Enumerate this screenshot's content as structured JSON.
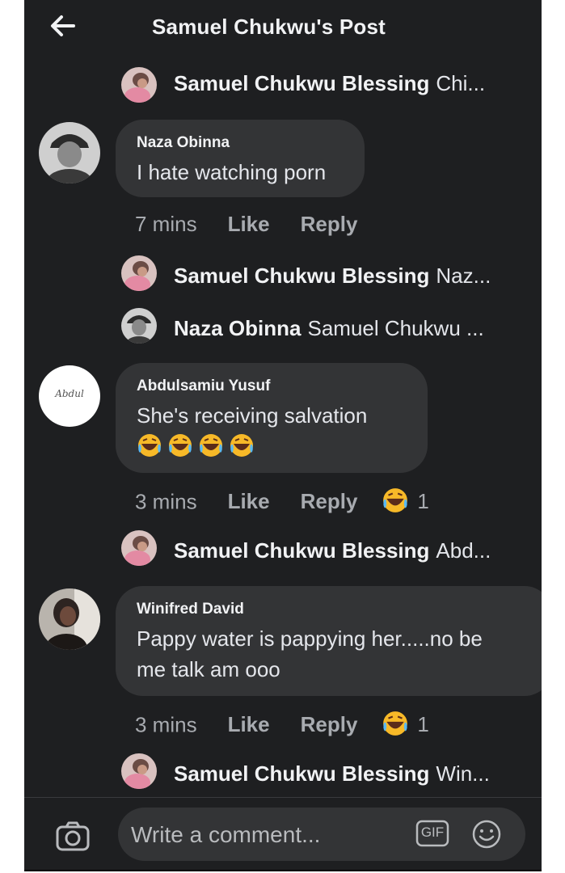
{
  "header": {
    "title": "Samuel Chukwu's Post",
    "back_icon": "arrow-left-icon"
  },
  "replies": {
    "r1": {
      "name": "Samuel Chukwu Blessing",
      "snippet": "Chi..."
    },
    "r2": {
      "name": "Samuel Chukwu Blessing",
      "snippet": "Naz..."
    },
    "r3": {
      "name": "Naza Obinna",
      "snippet": "Samuel Chukwu ..."
    },
    "r4": {
      "name": "Samuel Chukwu Blessing",
      "snippet": "Abd..."
    },
    "r5": {
      "name": "Samuel Chukwu Blessing",
      "snippet": "Win..."
    }
  },
  "comments": {
    "c1": {
      "author": "Naza Obinna",
      "text": "I hate watching porn",
      "time": "7 mins",
      "like": "Like",
      "reply": "Reply"
    },
    "c2": {
      "author": "Abdulsamiu Yusuf",
      "text": "She's receiving salvation",
      "emojis": "😂😂😂😂",
      "time": "3 mins",
      "like": "Like",
      "reply": "Reply",
      "reaction_count": "1",
      "avatar_text": "Abdul"
    },
    "c3": {
      "author": "Winifred David",
      "text_line1": "Pappy water is pappying her.....no be",
      "text_line2": "me talk am ooo",
      "time": "3 mins",
      "like": "Like",
      "reply": "Reply",
      "reaction_count": "1"
    }
  },
  "composer": {
    "placeholder": "Write a comment...",
    "gif_label": "GIF",
    "camera_icon": "camera-icon",
    "emoji_icon": "smiley-icon"
  },
  "colors": {
    "background": "#1e1f21",
    "bubble": "#333436",
    "muted": "#a8abb0",
    "text": "#e4e6eb"
  }
}
